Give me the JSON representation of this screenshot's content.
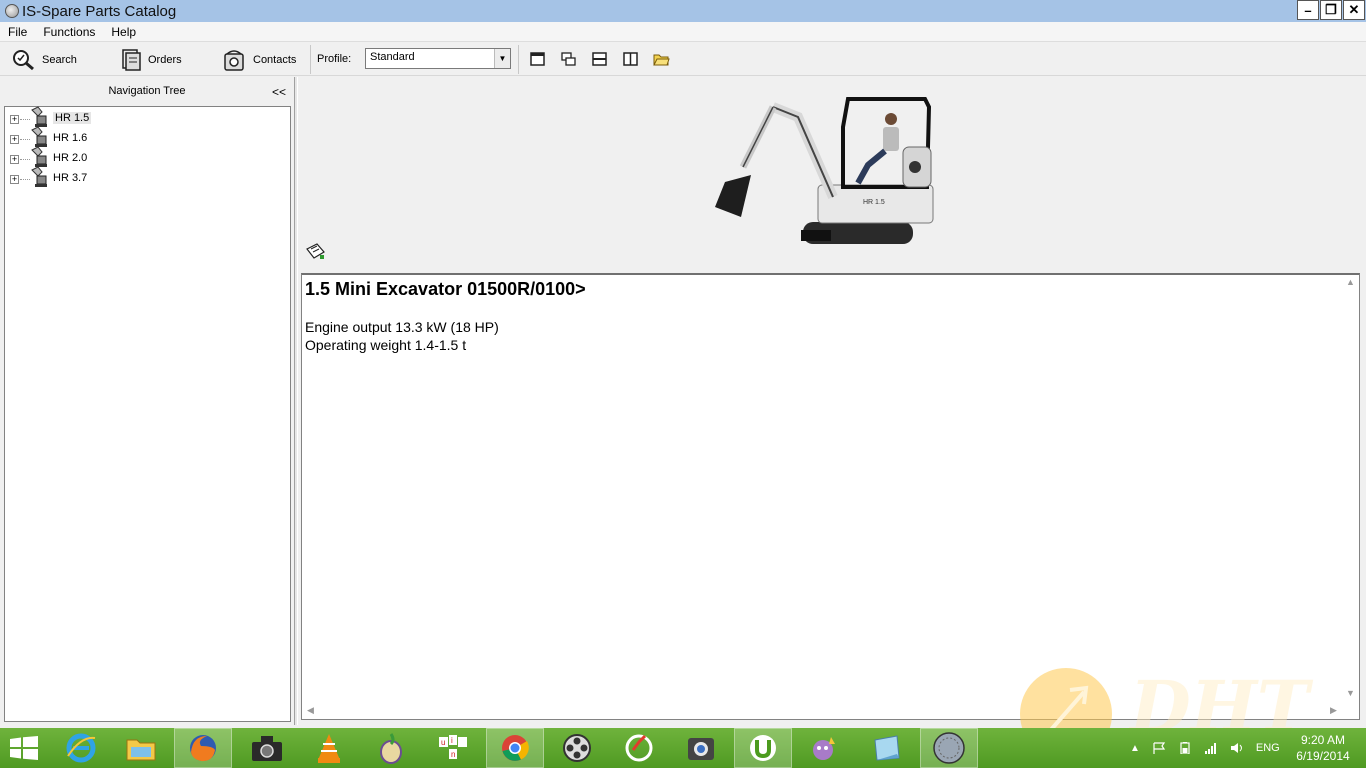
{
  "window": {
    "title": "IS-Spare Parts Catalog"
  },
  "menu": [
    "File",
    "Functions",
    "Help"
  ],
  "toolbar": {
    "search_label": "Search",
    "orders_label": "Orders",
    "contacts_label": "Contacts",
    "profile_label": "Profile:",
    "profile_value": "Standard"
  },
  "nav": {
    "header": "Navigation Tree",
    "collapse": "<<",
    "items": [
      {
        "label": "HR 1.5",
        "selected": true
      },
      {
        "label": "HR 1.6"
      },
      {
        "label": "HR 2.0"
      },
      {
        "label": "HR 3.7"
      }
    ]
  },
  "image": {
    "badge_label": "HR 1.5"
  },
  "content": {
    "title": "1.5 Mini Excavator 01500R/0100>",
    "engine": "Engine output 13.3 kW (18 HP)",
    "weight": "Operating weight 1.4-1.5 t"
  },
  "taskbar": {
    "apps": [
      "internet-explorer",
      "file-explorer",
      "firefox",
      "camera",
      "vlc",
      "tor",
      "app-un",
      "chrome",
      "film-reel",
      "cclean",
      "photo",
      "utorrent",
      "messenger",
      "notes",
      "is-spare-parts"
    ],
    "language": "ENG",
    "time": "9:20 AM",
    "date": "6/19/2014"
  },
  "watermark": {
    "text": "DHT"
  },
  "colors": {
    "titlebar": "#a5c3e6",
    "taskbar": "#5aa52b"
  }
}
